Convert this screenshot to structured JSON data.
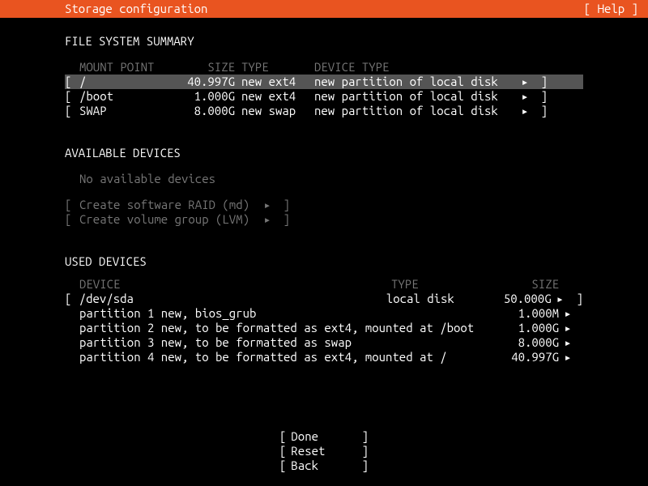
{
  "header": {
    "title": "Storage configuration",
    "help": "[ Help ]"
  },
  "summary": {
    "heading": "FILE SYSTEM SUMMARY",
    "cols": {
      "mount": "MOUNT POINT",
      "size": "SIZE",
      "type": "TYPE",
      "dtype": "DEVICE TYPE"
    },
    "rows": [
      {
        "mount": "/",
        "size": "40.997G",
        "type": "new ext4",
        "dtype": "new partition of local disk",
        "tri": "▸",
        "selected": true
      },
      {
        "mount": "/boot",
        "size": "1.000G",
        "type": "new ext4",
        "dtype": "new partition of local disk",
        "tri": "▸",
        "selected": false
      },
      {
        "mount": "SWAP",
        "size": "8.000G",
        "type": "new swap",
        "dtype": "new partition of local disk",
        "tri": "▸",
        "selected": false
      }
    ]
  },
  "available": {
    "heading": "AVAILABLE DEVICES",
    "none": "No available devices",
    "raid": "Create software RAID (md)",
    "lvm": "Create volume group (LVM)",
    "tri": "▸"
  },
  "used": {
    "heading": "USED DEVICES",
    "cols": {
      "device": "DEVICE",
      "type": "TYPE",
      "size": "SIZE"
    },
    "disk": {
      "name": "/dev/sda",
      "type": "local disk",
      "size": "50.000G",
      "tri": "▸"
    },
    "parts": [
      {
        "desc": "partition 1  new, bios_grub",
        "size": "1.000M",
        "tri": "▸"
      },
      {
        "desc": "partition 2  new, to be formatted as ext4, mounted at /boot",
        "size": "1.000G",
        "tri": "▸"
      },
      {
        "desc": "partition 3  new, to be formatted as swap",
        "size": "8.000G",
        "tri": "▸"
      },
      {
        "desc": "partition 4  new, to be formatted as ext4, mounted at /",
        "size": "40.997G",
        "tri": "▸"
      }
    ]
  },
  "actions": {
    "done": "Done",
    "reset": "Reset",
    "back": "Back"
  },
  "glyph": {
    "lb": "[",
    "rb": "]"
  }
}
